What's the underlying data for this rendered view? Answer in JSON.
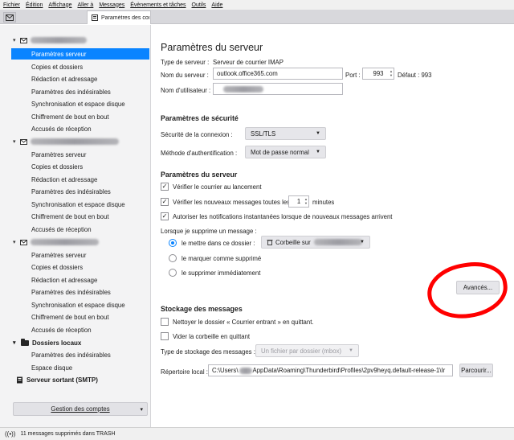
{
  "menubar": {
    "items": [
      "Fichier",
      "Édition",
      "Affichage",
      "Aller à",
      "Messages",
      "Évènements et tâches",
      "Outils",
      "Aide"
    ]
  },
  "tab": {
    "label": "Paramètres des comptes Co",
    "icon": "settings-tab-icon"
  },
  "sidebar": {
    "account_items": [
      "Paramètres serveur",
      "Copies et dossiers",
      "Rédaction et adressage",
      "Paramètres des indésirables",
      "Synchronisation et espace disque",
      "Chiffrement de bout en bout",
      "Accusés de réception"
    ],
    "local_folders": {
      "label": "Dossiers locaux",
      "items": [
        "Paramètres des indésirables",
        "Espace disque"
      ]
    },
    "smtp_label": "Serveur sortant (SMTP)",
    "manage_button": "Gestion des comptes"
  },
  "main": {
    "title": "Paramètres du serveur",
    "server_type_label": "Type de serveur :",
    "server_type_value": "Serveur de courrier IMAP",
    "server_name_label": "Nom du serveur :",
    "server_name_value": "outlook.office365.com",
    "port_label": "Port :",
    "port_value": "993",
    "default_label": "Défaut : 993",
    "username_label": "Nom d'utilisateur :",
    "security": {
      "heading": "Paramètres de sécurité",
      "conn_security_label": "Sécurité de la connexion :",
      "conn_security_value": "SSL/TLS",
      "auth_method_label": "Méthode d'authentification :",
      "auth_method_value": "Mot de passe normal"
    },
    "server_settings": {
      "heading": "Paramètres du serveur",
      "check_startup": "Vérifier le courrier au lancement",
      "check_every": "Vérifier les nouveaux messages toutes les",
      "check_every_value": "1",
      "minutes": "minutes",
      "push_notifications": "Autoriser les notifications instantanées lorsque de nouveaux messages arrivent",
      "delete_label": "Lorsque je supprime un message :",
      "move_to_folder": "le mettre dans ce dossier :",
      "trash_folder_prefix": "Corbeille sur",
      "mark_deleted": "le marquer comme supprimé",
      "delete_immediately": "le supprimer immédiatement",
      "advanced_button": "Avancés..."
    },
    "storage": {
      "heading": "Stockage des messages",
      "clean_inbox": "Nettoyer le dossier « Courrier entrant » en quittant.",
      "empty_trash": "Vider la corbeille en quittant",
      "store_type_label": "Type de stockage des messages :",
      "store_type_value": "Un fichier par dossier (mbox)",
      "local_dir_label": "Répertoire local :",
      "local_dir_prefix": "C:\\Users\\",
      "local_dir_suffix": "AppData\\Roaming\\Thunderbird\\Profiles\\2pv9heyq.default-release-1\\Ir",
      "browse_button": "Parcourir..."
    }
  },
  "status": {
    "text": "11 messages supprimés dans TRASH",
    "icon": "connection-icon"
  },
  "colors": {
    "selection": "#0a84ff",
    "annotation": "#ff0000"
  }
}
